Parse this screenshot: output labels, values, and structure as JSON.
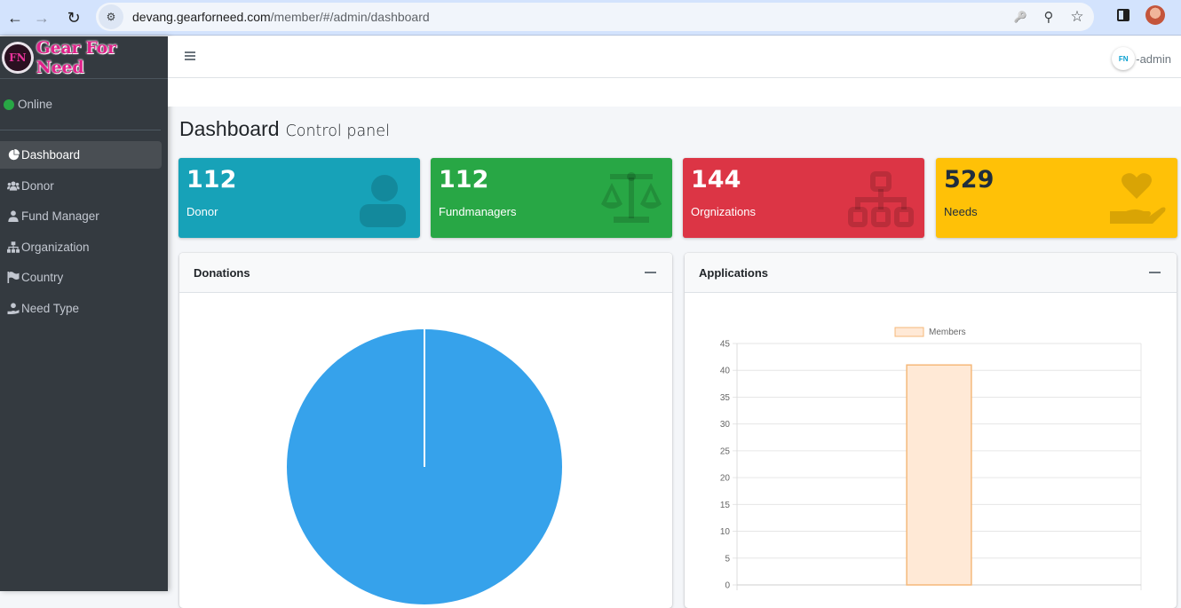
{
  "browser": {
    "url_host": "devang.gearforneed.com",
    "url_path": "/member/#/admin/dashboard",
    "back_icon": "←",
    "forward_icon": "→",
    "reload_icon": "↻",
    "site_info_icon": "⚙",
    "key_icon": "🔑",
    "zoom_icon": "⚲",
    "star_icon": "☆"
  },
  "sidebar": {
    "brand_logo": "FN",
    "brand_name": "Gear For Need",
    "status": "Online",
    "items": [
      {
        "label": "Dashboard",
        "icon": "◔",
        "active": true
      },
      {
        "label": "Donor",
        "icon": "👥",
        "active": false
      },
      {
        "label": "Fund Manager",
        "icon": "👤",
        "active": false
      },
      {
        "label": "Organization",
        "icon": "⊞",
        "active": false
      },
      {
        "label": "Country",
        "icon": "⚑",
        "active": false
      },
      {
        "label": "Need Type",
        "icon": "♥",
        "active": false
      }
    ]
  },
  "topbar": {
    "user_logo": "FN",
    "user_label": "-admin"
  },
  "header": {
    "title": "Dashboard",
    "subtitle": "Control panel"
  },
  "stats": [
    {
      "value": "112",
      "label": "Donor",
      "color": "#17a2b8",
      "icon": "user-icon"
    },
    {
      "value": "112",
      "label": "Fundmanagers",
      "color": "#28a745",
      "icon": "balance-scale-icon"
    },
    {
      "value": "144",
      "label": "Orgnizations",
      "color": "#dc3545",
      "icon": "sitemap-icon"
    },
    {
      "value": "529",
      "label": "Needs",
      "color": "#ffc107",
      "icon": "hand-holding-heart-icon"
    }
  ],
  "cards": {
    "donations_title": "Donations",
    "applications_title": "Applications"
  },
  "chart_data": [
    {
      "type": "pie",
      "title": "Donations",
      "slices": [
        {
          "label": "",
          "value": 100,
          "color": "#36a2eb"
        }
      ],
      "legend": "none"
    },
    {
      "type": "bar",
      "title": "Applications",
      "categories": [
        ""
      ],
      "series": [
        {
          "name": "Members",
          "values": [
            41
          ],
          "fill": "#ffe9d6",
          "stroke": "#f5b87a"
        }
      ],
      "xlabel": "",
      "ylabel": "",
      "ylim": [
        0,
        45
      ],
      "yticks": [
        0,
        5,
        10,
        15,
        20,
        25,
        30,
        35,
        40,
        45
      ],
      "grid": true,
      "legend": "top-center"
    }
  ]
}
